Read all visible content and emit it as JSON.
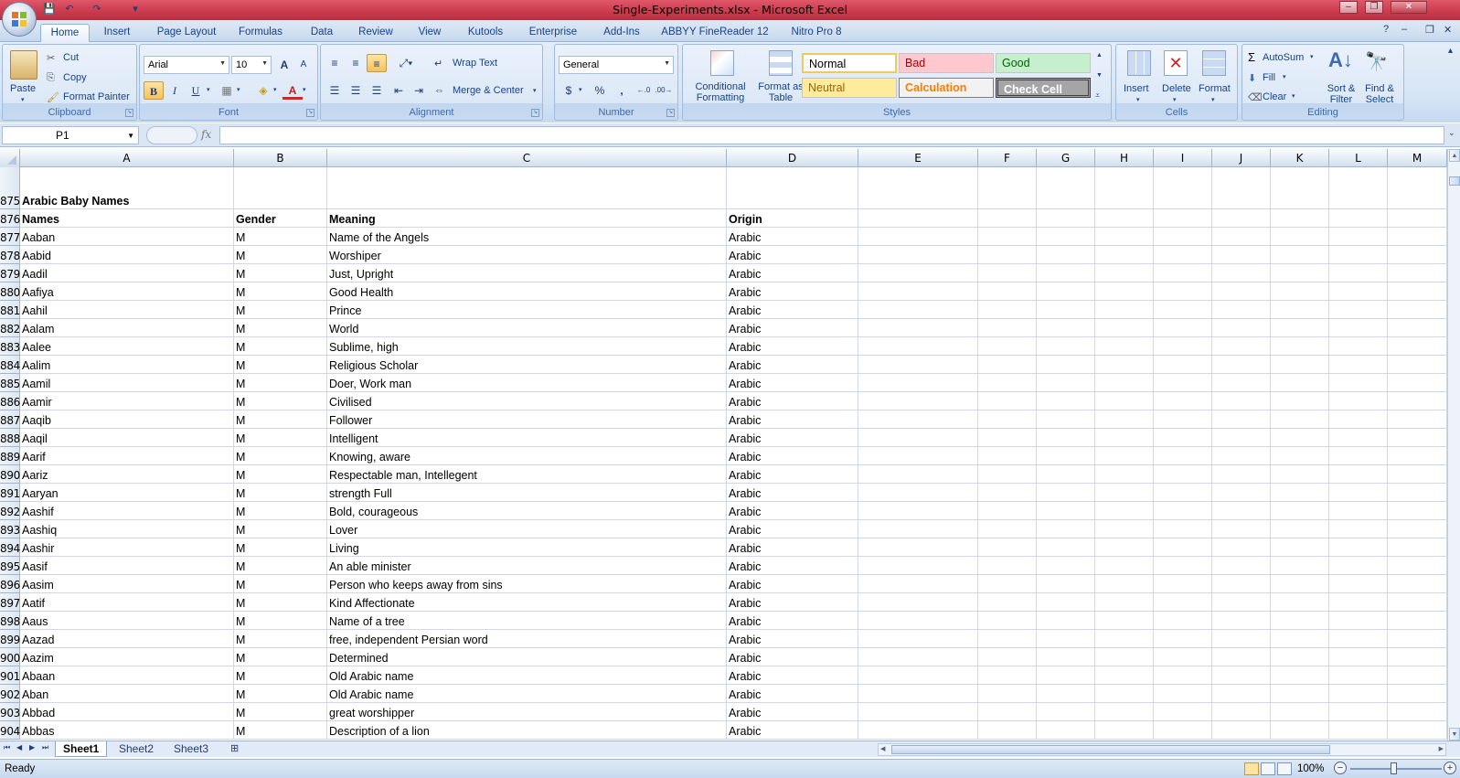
{
  "window": {
    "title": "Single-Experiments.xlsx - Microsoft Excel",
    "minimize": "–",
    "restore": "❐",
    "close": "✕"
  },
  "ribbon_tabs": [
    "Home",
    "Insert",
    "Page Layout",
    "Formulas",
    "Data",
    "Review",
    "View",
    "Kutools",
    "Enterprise",
    "Add-Ins",
    "ABBYY FineReader 12",
    "Nitro Pro 8"
  ],
  "clipboard": {
    "paste": "Paste",
    "cut": "Cut",
    "copy": "Copy",
    "format_painter": "Format Painter",
    "label": "Clipboard"
  },
  "font": {
    "name": "Arial",
    "size": "10",
    "grow": "A",
    "shrink": "A",
    "bold": "B",
    "italic": "I",
    "underline": "U",
    "font_color": "A",
    "label": "Font"
  },
  "alignment": {
    "wrap_text": "Wrap Text",
    "merge_center": "Merge & Center",
    "label": "Alignment"
  },
  "number": {
    "format": "General",
    "currency": "$",
    "percent": "%",
    "comma": ",",
    "increase_decimal": ".00→.0",
    "decrease_decimal": ".00",
    "label": "Number"
  },
  "styles": {
    "conditional_formatting": "Conditional Formatting",
    "format_as_table": "Format as Table",
    "normal": "Normal",
    "bad": "Bad",
    "good": "Good",
    "neutral": "Neutral",
    "calculation": "Calculation",
    "check_cell": "Check Cell",
    "label": "Styles"
  },
  "cells_group": {
    "insert": "Insert",
    "delete": "Delete",
    "format": "Format",
    "label": "Cells"
  },
  "editing": {
    "autosum": "AutoSum",
    "fill": "Fill",
    "clear": "Clear",
    "sort_filter": "Sort & Filter",
    "find_select": "Find & Select",
    "label": "Editing"
  },
  "formula_bar": {
    "name_box": "P1",
    "fx": "fx",
    "value": ""
  },
  "columns": [
    "A",
    "B",
    "C",
    "D",
    "E",
    "F",
    "G",
    "H",
    "I",
    "J",
    "K",
    "L",
    "M"
  ],
  "rows": [
    {
      "num": "875",
      "a": "Arabic Baby Names",
      "b": "",
      "c": "",
      "d": "",
      "bold": true
    },
    {
      "num": "876",
      "a": "Names",
      "b": "Gender",
      "c": "Meaning",
      "d": "Origin",
      "bold": true
    },
    {
      "num": "877",
      "a": "Aaban",
      "b": "M",
      "c": "Name of the Angels",
      "d": "Arabic"
    },
    {
      "num": "878",
      "a": "Aabid",
      "b": "M",
      "c": "Worshiper",
      "d": "Arabic"
    },
    {
      "num": "879",
      "a": "Aadil",
      "b": "M",
      "c": "Just, Upright",
      "d": "Arabic"
    },
    {
      "num": "880",
      "a": "Aafiya",
      "b": "M",
      "c": "Good Health",
      "d": "Arabic"
    },
    {
      "num": "881",
      "a": "Aahil",
      "b": "M",
      "c": "Prince",
      "d": "Arabic"
    },
    {
      "num": "882",
      "a": "Aalam",
      "b": "M",
      "c": "World",
      "d": "Arabic"
    },
    {
      "num": "883",
      "a": "Aalee",
      "b": "M",
      "c": "Sublime, high",
      "d": "Arabic"
    },
    {
      "num": "884",
      "a": "Aalim",
      "b": "M",
      "c": "Religious Scholar",
      "d": "Arabic"
    },
    {
      "num": "885",
      "a": "Aamil",
      "b": "M",
      "c": "Doer, Work man",
      "d": "Arabic"
    },
    {
      "num": "886",
      "a": "Aamir",
      "b": "M",
      "c": "Civilised",
      "d": "Arabic"
    },
    {
      "num": "887",
      "a": "Aaqib",
      "b": "M",
      "c": "Follower",
      "d": "Arabic"
    },
    {
      "num": "888",
      "a": "Aaqil",
      "b": "M",
      "c": "Intelligent",
      "d": "Arabic"
    },
    {
      "num": "889",
      "a": "Aarif",
      "b": "M",
      "c": "Knowing, aware",
      "d": "Arabic"
    },
    {
      "num": "890",
      "a": "Aariz",
      "b": "M",
      "c": "Respectable man, Intellegent",
      "d": "Arabic"
    },
    {
      "num": "891",
      "a": "Aaryan",
      "b": "M",
      "c": "strength Full",
      "d": "Arabic"
    },
    {
      "num": "892",
      "a": "Aashif",
      "b": "M",
      "c": "Bold, courageous",
      "d": "Arabic"
    },
    {
      "num": "893",
      "a": "Aashiq",
      "b": "M",
      "c": "Lover",
      "d": "Arabic"
    },
    {
      "num": "894",
      "a": "Aashir",
      "b": "M",
      "c": "Living",
      "d": "Arabic"
    },
    {
      "num": "895",
      "a": "Aasif",
      "b": "M",
      "c": "An able minister",
      "d": "Arabic"
    },
    {
      "num": "896",
      "a": "Aasim",
      "b": "M",
      "c": "Person who keeps away from sins",
      "d": "Arabic"
    },
    {
      "num": "897",
      "a": "Aatif",
      "b": "M",
      "c": "Kind Affectionate",
      "d": "Arabic"
    },
    {
      "num": "898",
      "a": "Aaus",
      "b": "M",
      "c": "Name of a tree",
      "d": "Arabic"
    },
    {
      "num": "899",
      "a": "Aazad",
      "b": "M",
      "c": "free, independent Persian word",
      "d": "Arabic"
    },
    {
      "num": "900",
      "a": "Aazim",
      "b": "M",
      "c": "Determined",
      "d": "Arabic"
    },
    {
      "num": "901",
      "a": "Abaan",
      "b": "M",
      "c": "Old Arabic name",
      "d": "Arabic"
    },
    {
      "num": "902",
      "a": "Aban",
      "b": "M",
      "c": "Old Arabic name",
      "d": "Arabic"
    },
    {
      "num": "903",
      "a": "Abbad",
      "b": "M",
      "c": "great worshipper",
      "d": "Arabic"
    },
    {
      "num": "904",
      "a": "Abbas",
      "b": "M",
      "c": "Description of a lion",
      "d": "Arabic"
    }
  ],
  "sheets": [
    "Sheet1",
    "Sheet2",
    "Sheet3"
  ],
  "active_sheet": "Sheet1",
  "status": {
    "text": "Ready",
    "zoom": "100%"
  },
  "colors": {
    "accent": "#15428b",
    "bad_bg": "#ffc7ce",
    "good_bg": "#c6efce",
    "neutral_bg": "#ffeb9c",
    "check_bg": "#a5a5a5"
  }
}
